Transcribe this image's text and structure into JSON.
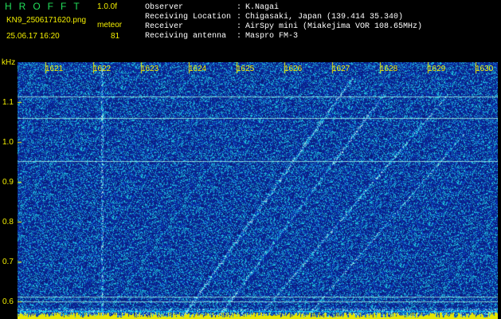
{
  "header": {
    "app_title": "HROFFT",
    "version": "1.0.0f",
    "filename": "KN9_2506171620.png",
    "timestamp": "25.06.17 16:20",
    "meteor_label": "meteor",
    "meteor_count": "81"
  },
  "info": [
    {
      "label": "Observer",
      "value": "K.Nagai"
    },
    {
      "label": "Receiving Location",
      "value": "Chigasaki, Japan (139.414 35.340)"
    },
    {
      "label": "Receiver",
      "value": "AirSpy mini (Miakejima VOR 108.65MHz)"
    },
    {
      "label": "Receiving antenna",
      "value": "Maspro FM-3"
    }
  ],
  "info_separator": ":",
  "axis": {
    "unit": "kHz",
    "freq_ticks": [
      "1.1",
      "1.0",
      "0.9",
      "0.8",
      "0.7",
      "0.6"
    ],
    "time_ticks": [
      "1621",
      "1622",
      "1623",
      "1624",
      "1625",
      "1626",
      "1627",
      "1628",
      "1629",
      "1630"
    ]
  },
  "colors": {
    "background": "#000000",
    "header_green": "#22e05a",
    "header_yellow": "#f4f000",
    "spectrogram_base": "#0c1e96",
    "signal": "#8cfadc"
  }
}
